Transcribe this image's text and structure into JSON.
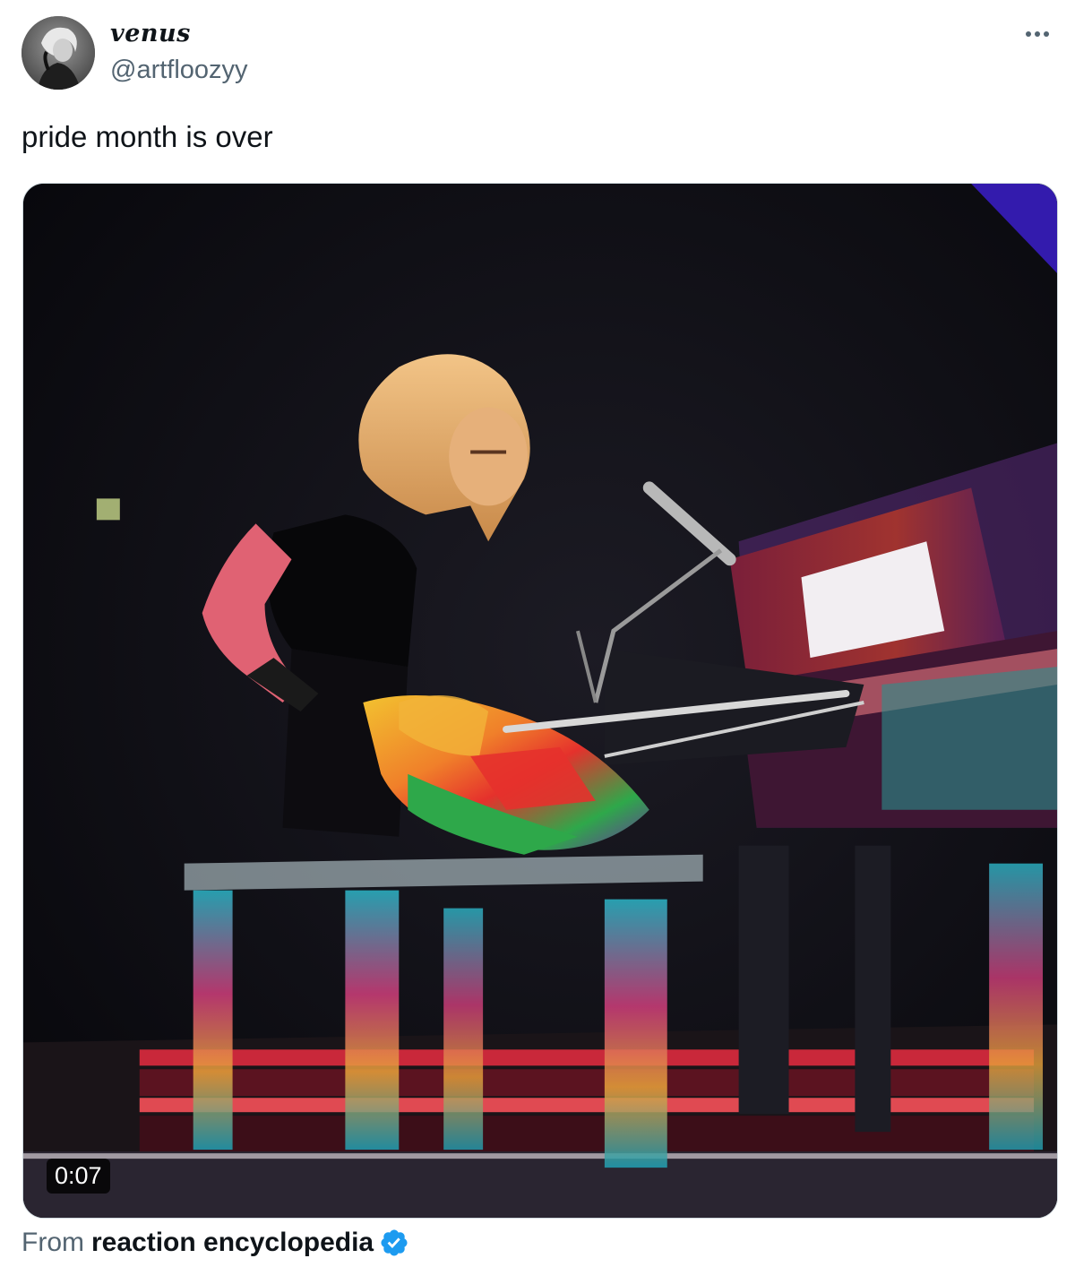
{
  "tweet": {
    "author": {
      "display_name": "venus",
      "handle": "@artfloozyy"
    },
    "text": "pride month is over",
    "media": {
      "duration": "0:07"
    },
    "attribution": {
      "prefix": "From",
      "source": "reaction encyclopedia"
    },
    "icons": {
      "more": "more-horizontal-icon",
      "verified": "verified-badge-icon"
    }
  },
  "colors": {
    "text_primary": "#0f1419",
    "text_secondary": "#536471",
    "verified_blue": "#1d9bf0",
    "media_background": "#0b0a10"
  }
}
